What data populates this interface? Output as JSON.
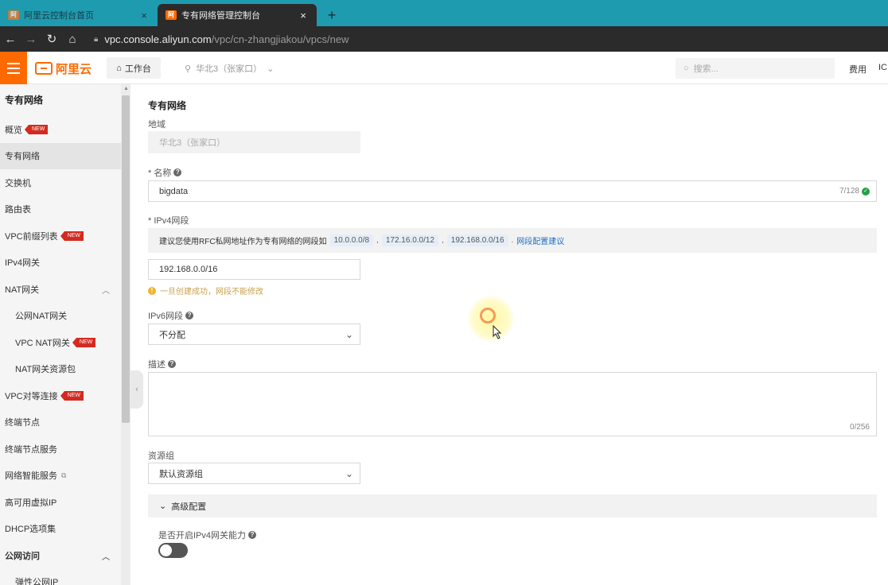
{
  "browser": {
    "tabs": [
      {
        "title": "阿里云控制台首页",
        "active": false
      },
      {
        "title": "专有网络管理控制台",
        "active": true
      }
    ],
    "new_tab": "+",
    "close_glyph": "×",
    "url_host": "vpc.console.aliyun.com",
    "url_path": "/vpc/cn-zhangjiakou/vpcs/new"
  },
  "topbar": {
    "logo_text": "阿里云",
    "workbench_label": "工作台",
    "region_label": "华北3（张家口）",
    "search_placeholder": "搜索...",
    "menu_fee": "费用",
    "menu_icp": "ICI",
    "brand_color": "#ff6a00"
  },
  "sidebar": {
    "title": "专有网络",
    "items": [
      {
        "label": "概览",
        "new": true
      },
      {
        "label": "专有网络",
        "active": true
      },
      {
        "label": "交换机"
      },
      {
        "label": "路由表"
      },
      {
        "label": "VPC前缀列表",
        "new": true
      },
      {
        "label": "IPv4网关"
      },
      {
        "label": "NAT网关",
        "expandable": true
      },
      {
        "label": "公网NAT网关",
        "sub": true
      },
      {
        "label": "VPC NAT网关",
        "sub": true,
        "new": true
      },
      {
        "label": "NAT网关资源包",
        "sub": true
      },
      {
        "label": "VPC对等连接",
        "new": true
      },
      {
        "label": "终端节点"
      },
      {
        "label": "终端节点服务"
      },
      {
        "label": "网络智能服务",
        "external": true
      },
      {
        "label": "高可用虚拟IP"
      },
      {
        "label": "DHCP选项集"
      },
      {
        "label": "公网访问",
        "group": true,
        "expandable": true
      },
      {
        "label": "弹性公网IP",
        "sub": true
      }
    ],
    "new_badge": "NEW"
  },
  "form": {
    "title": "专有网络",
    "region_label": "地域",
    "region_value": "华北3（张家口）",
    "name_label": "* 名称",
    "name_value": "bigdata",
    "name_counter": "7/128",
    "ipv4_label": "* IPv4网段",
    "hint_text": "建议您使用RFC私网地址作为专有网络的网段如",
    "hint_cidrs": [
      "10.0.0.0/8",
      "172.16.0.0/12",
      "192.168.0.0/16"
    ],
    "hint_sep": ",",
    "hint_end": ".",
    "hint_link": "网段配置建议",
    "ipv4_value": "192.168.0.0/16",
    "ipv4_warning": "一旦创建成功，网段不能修改",
    "ipv6_label": "IPv6网段",
    "ipv6_value": "不分配",
    "desc_label": "描述",
    "desc_counter": "0/256",
    "rg_label": "资源组",
    "rg_value": "默认资源组",
    "advanced_label": "高级配置",
    "ipv4gw_label": "是否开启IPv4网关能力",
    "ipv4gw_enabled": false
  }
}
